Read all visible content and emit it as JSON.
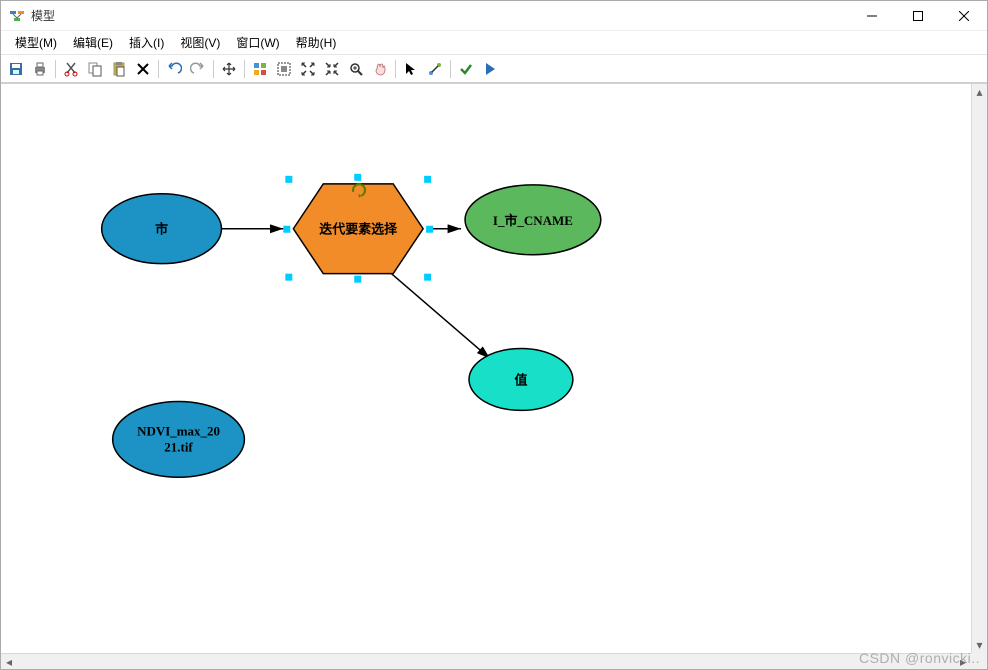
{
  "window": {
    "title": "模型"
  },
  "menus": {
    "m0": "模型(M)",
    "m1": "编辑(E)",
    "m2": "插入(I)",
    "m3": "视图(V)",
    "m4": "窗口(W)",
    "m5": "帮助(H)"
  },
  "toolbar": {
    "save": "save-icon",
    "print": "print-icon",
    "cut": "cut-icon",
    "copy": "copy-icon",
    "paste": "paste-icon",
    "delete": "delete-icon",
    "undo": "undo-icon",
    "redo": "redo-icon",
    "move": "move-icon",
    "layout_auto": "auto-layout-icon",
    "zoom_in": "zoom-in-icon",
    "fit": "fit-icon",
    "full": "fullscreen-icon",
    "zoom": "zoom-icon",
    "pan": "pan-icon",
    "select": "select-tool-icon",
    "connect": "connect-tool-icon",
    "validate": "validate-icon",
    "run": "run-icon"
  },
  "nodes": {
    "input_city": "市",
    "iterator": "迭代要素选择",
    "output_cname": "I_市_CNAME",
    "output_value": "值",
    "ndvi": "NDVI_max_2021.tif",
    "ndvi_line1": "NDVI_max_20",
    "ndvi_line2": "21.tif"
  },
  "colors": {
    "input_fill": "#1C93C4",
    "iterator_fill": "#F28C28",
    "output_fill": "#4CAF50",
    "value_fill": "#18E0C8",
    "stroke": "#000000",
    "selection": "#00CCFF"
  },
  "watermark": "CSDN @ronvicki.."
}
